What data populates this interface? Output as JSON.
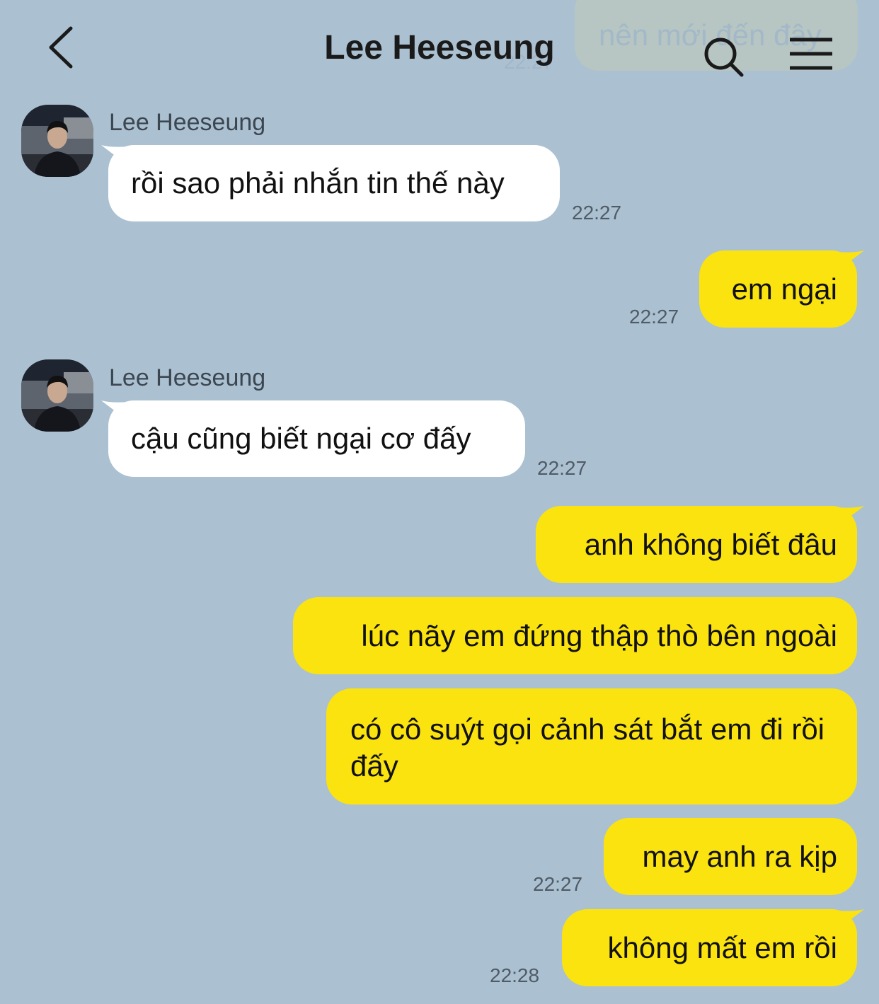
{
  "header": {
    "title": "Lee Heeseung"
  },
  "previous_message": {
    "text": "nên mới đến đây",
    "time": "22:27"
  },
  "messages": [
    {
      "direction": "incoming",
      "sender": "Lee Heeseung",
      "text": "rồi sao phải nhắn tin thế này",
      "time": "22:27"
    },
    {
      "direction": "outgoing",
      "text": "em ngại",
      "time": "22:27"
    },
    {
      "direction": "incoming",
      "sender": "Lee Heeseung",
      "text": "cậu cũng biết ngại cơ đấy",
      "time": "22:27"
    },
    {
      "direction": "outgoing",
      "text": "anh không biết đâu"
    },
    {
      "direction": "outgoing",
      "text": "lúc nãy em đứng thập thò bên ngoài"
    },
    {
      "direction": "outgoing",
      "text": "có cô suýt gọi cảnh sát bắt em đi rồi đấy"
    },
    {
      "direction": "outgoing",
      "text": "may anh ra kịp",
      "time": "22:27"
    },
    {
      "direction": "outgoing",
      "text": "không mất em rồi",
      "time": "22:28"
    }
  ],
  "icons": {
    "back": "chevron-left-icon",
    "search": "search-icon",
    "menu": "hamburger-menu-icon",
    "avatar": "profile-photo"
  },
  "colors": {
    "background": "#abc1d1",
    "incoming_bubble": "#ffffff",
    "outgoing_bubble": "#fbe30f",
    "timestamp": "#4f5b66"
  }
}
